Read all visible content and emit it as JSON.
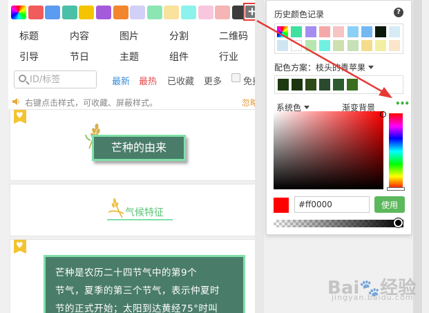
{
  "swatches": [
    "rainbow",
    "#f15b5b",
    "#5b9bf1",
    "#4bc0a8",
    "#f5c400",
    "#a35bdc",
    "#f3862d",
    "#d2d0f7",
    "#8ce6b4",
    "#f8e29c",
    "#8cf2ec",
    "#f8c7dd",
    "#f5b5b5",
    "#3c3c3c"
  ],
  "plus_icon": "+",
  "categories": {
    "row1": [
      "标题",
      "内容",
      "图片",
      "分割",
      "二维码"
    ],
    "row2": [
      "引导",
      "节日",
      "主题",
      "组件",
      "行业"
    ]
  },
  "search": {
    "placeholder": "ID/标签"
  },
  "filters": {
    "newest": "最新",
    "hottest": "最热",
    "saved": "已收藏",
    "more": "更多",
    "free": "免费"
  },
  "filter_colors": {
    "newest": "#3b8fd8",
    "hottest": "#e24c4c",
    "default": "#555555"
  },
  "hint": {
    "text": "右键点击样式，可收藏、屏蔽样式。",
    "ignore": "忽略"
  },
  "preview": {
    "title": "芒种的由来",
    "subtitle": "气候特征",
    "body_lines": [
      "芒种是农历二十四节气中的第9个",
      "节气，夏季的第三个节气，表示仲夏时",
      "节的正式开始；太阳到达黄经75°时叫"
    ]
  },
  "picker": {
    "history_title": "历史颜色记录",
    "help_icon": "?",
    "history_colors": [
      "rainbow",
      "#40e0a0",
      "#a58cf2",
      "#f5a8a8",
      "#f7c3c3",
      "#8cd0f5",
      "#74b8f2",
      "#0a1a0a",
      "#d6ecf5",
      "#cfe6f2",
      "#ffffff",
      "#b8e6b0",
      "#70f0e0",
      "#cfe0b0",
      "#c6e0b8",
      "#f5dc8c",
      "#f2f0a0",
      "#fbe6cc"
    ],
    "scheme_label": "配色方案：",
    "scheme_name": "枝头的青苹果",
    "scheme_colors": [
      "#1e3a10",
      "#1c3510",
      "#2e4a18",
      "#2a4a30",
      "#2e5a30",
      "#3a6e1e"
    ],
    "system_color": "系统色",
    "gradient_bg": "渐变背景",
    "more_dots": "•••",
    "current_color": "#ff0000",
    "hex_value": "#ff0000",
    "use_button": "使用"
  },
  "watermark": {
    "brand": "Bai",
    "paw": "🐾",
    "suffix": "经验",
    "sub": "jingyan.baidu.com"
  }
}
